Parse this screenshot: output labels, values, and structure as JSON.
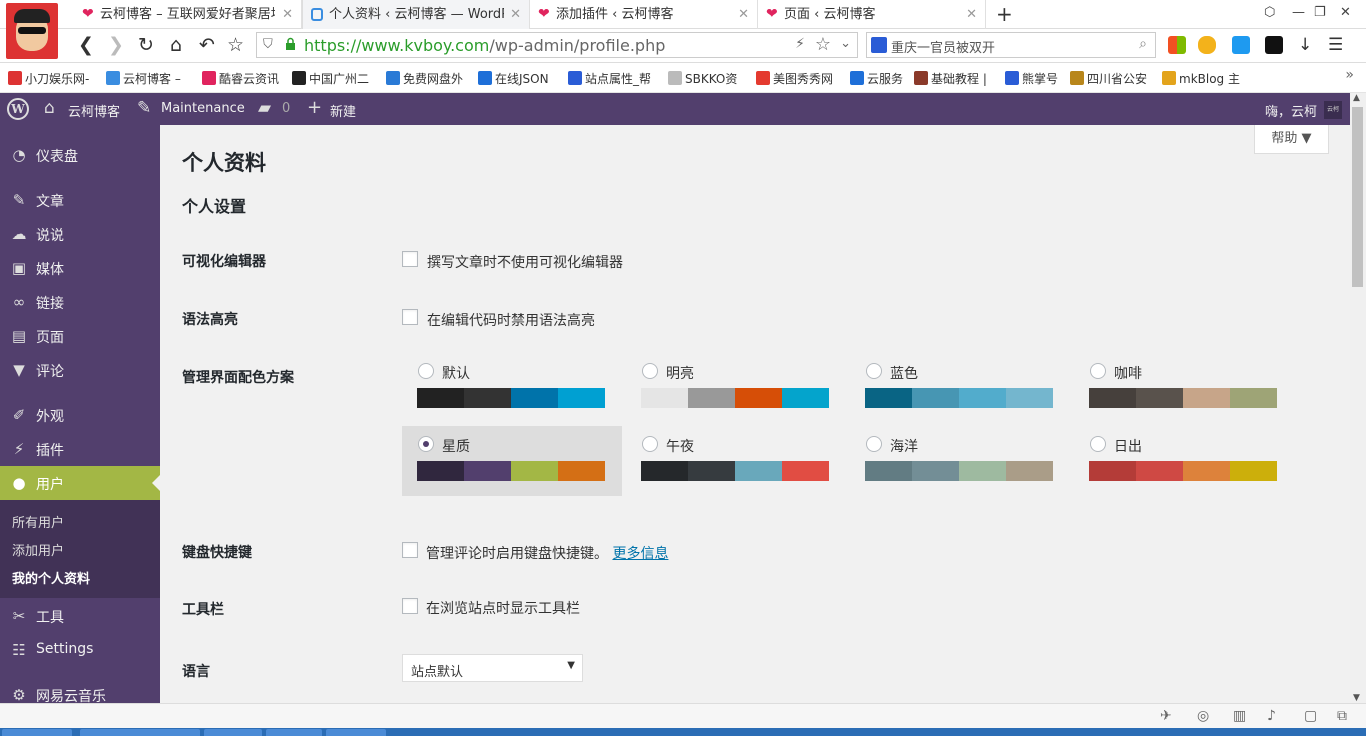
{
  "browser": {
    "tabs": [
      {
        "title": "云柯博客 – 互联网爱好者聚居地",
        "icon": "heart-icon",
        "active": false
      },
      {
        "title": "个人资料 ‹ 云柯博客 — WordPress",
        "icon": "wp-favicon-icon",
        "active": true
      },
      {
        "title": "添加插件 ‹ 云柯博客",
        "icon": "heart-icon",
        "active": false
      },
      {
        "title": "页面 ‹ 云柯博客",
        "icon": "heart-icon",
        "active": false
      }
    ],
    "url_host": "https://www.kvboy.com",
    "url_path": "/wp-admin/profile.php",
    "search_text": "重庆一官员被双开",
    "bookmarks": [
      {
        "label": "小刀娱乐网-",
        "color": "#d33"
      },
      {
        "label": "云柯博客 –",
        "color": "#3a8de0"
      },
      {
        "label": "酷睿云资讯",
        "color": "#e0245e"
      },
      {
        "label": "中国广州二",
        "color": "#222"
      },
      {
        "label": "免费网盘外",
        "color": "#2a7ad6"
      },
      {
        "label": "在线JSON",
        "color": "#1e6fd8"
      },
      {
        "label": "站点属性_帮",
        "color": "#2a5cd6"
      },
      {
        "label": "SBKKO资",
        "color": "#bbb"
      },
      {
        "label": "美图秀秀网",
        "color": "#e43a2f"
      },
      {
        "label": "云服务",
        "color": "#1e6fd8"
      },
      {
        "label": "基础教程 |",
        "color": "#8b3a2a"
      },
      {
        "label": "熊掌号",
        "color": "#2a5cd6"
      },
      {
        "label": "四川省公安",
        "color": "#b8861b"
      },
      {
        "label": "mkBlog 主",
        "color": "#e3a41c"
      }
    ]
  },
  "adminbar": {
    "site_name": "云柯博客",
    "maintenance": "Maintenance",
    "comments_count": "0",
    "new_label": "新建",
    "howdy": "嗨，云柯",
    "avatar_text": "云柯"
  },
  "sidebar": {
    "items": [
      {
        "label": "仪表盘",
        "icon": "dashboard-icon",
        "glyph": "◔"
      },
      {
        "label": "文章",
        "icon": "pin-icon",
        "glyph": "✎"
      },
      {
        "label": "说说",
        "icon": "speech-bubble-icon",
        "glyph": "☁"
      },
      {
        "label": "媒体",
        "icon": "media-icon",
        "glyph": "▣"
      },
      {
        "label": "链接",
        "icon": "link-icon",
        "glyph": "∞"
      },
      {
        "label": "页面",
        "icon": "page-icon",
        "glyph": "▤"
      },
      {
        "label": "评论",
        "icon": "comment-icon",
        "glyph": "▼"
      },
      {
        "label": "外观",
        "icon": "brush-icon",
        "glyph": "✐"
      },
      {
        "label": "插件",
        "icon": "plugin-icon",
        "glyph": "⚡"
      },
      {
        "label": "用户",
        "icon": "user-icon",
        "glyph": "●"
      },
      {
        "label": "工具",
        "icon": "wrench-icon",
        "glyph": "✂"
      },
      {
        "label": "Settings",
        "icon": "settings-icon",
        "glyph": "☷"
      },
      {
        "label": "网易云音乐",
        "icon": "gear-icon",
        "glyph": "⚙"
      }
    ],
    "submenu": [
      "所有用户",
      "添加用户",
      "我的个人资料"
    ]
  },
  "main": {
    "help_label": "帮助 ▼",
    "page_title": "个人资料",
    "section_title": "个人设置",
    "visual_editor": {
      "label": "可视化编辑器",
      "checkbox": "撰写文章时不使用可视化编辑器",
      "checked": false
    },
    "syntax_highlight": {
      "label": "语法高亮",
      "checkbox": "在编辑代码时禁用语法高亮",
      "checked": false
    },
    "color_scheme": {
      "label": "管理界面配色方案",
      "selected": "星质",
      "schemes": [
        {
          "name": "默认",
          "colors": [
            "#222222",
            "#333333",
            "#0073aa",
            "#00a0d2"
          ]
        },
        {
          "name": "明亮",
          "colors": [
            "#e5e5e5",
            "#999999",
            "#d64e07",
            "#04a4cc"
          ]
        },
        {
          "name": "蓝色",
          "colors": [
            "#096484",
            "#4796b3",
            "#52accc",
            "#74b6ce"
          ]
        },
        {
          "name": "咖啡",
          "colors": [
            "#46403c",
            "#59524c",
            "#c7a589",
            "#9ea476"
          ]
        },
        {
          "name": "星质",
          "colors": [
            "#30273e",
            "#523f6d",
            "#a3b745",
            "#d46f15"
          ]
        },
        {
          "name": "午夜",
          "colors": [
            "#25282b",
            "#363b3f",
            "#69a8bb",
            "#e14d43"
          ]
        },
        {
          "name": "海洋",
          "colors": [
            "#627c83",
            "#738e96",
            "#9ebaa0",
            "#aa9d88"
          ]
        },
        {
          "name": "日出",
          "colors": [
            "#b43c38",
            "#cf4944",
            "#dd823b",
            "#ccaf0b"
          ]
        }
      ]
    },
    "keyboard": {
      "label": "键盘快捷键",
      "checkbox": "管理评论时启用键盘快捷键。",
      "link": "更多信息",
      "checked": false
    },
    "toolbar": {
      "label": "工具栏",
      "checkbox": "在浏览站点时显示工具栏",
      "checked": false
    },
    "language": {
      "label": "语言",
      "value": "站点默认"
    }
  }
}
